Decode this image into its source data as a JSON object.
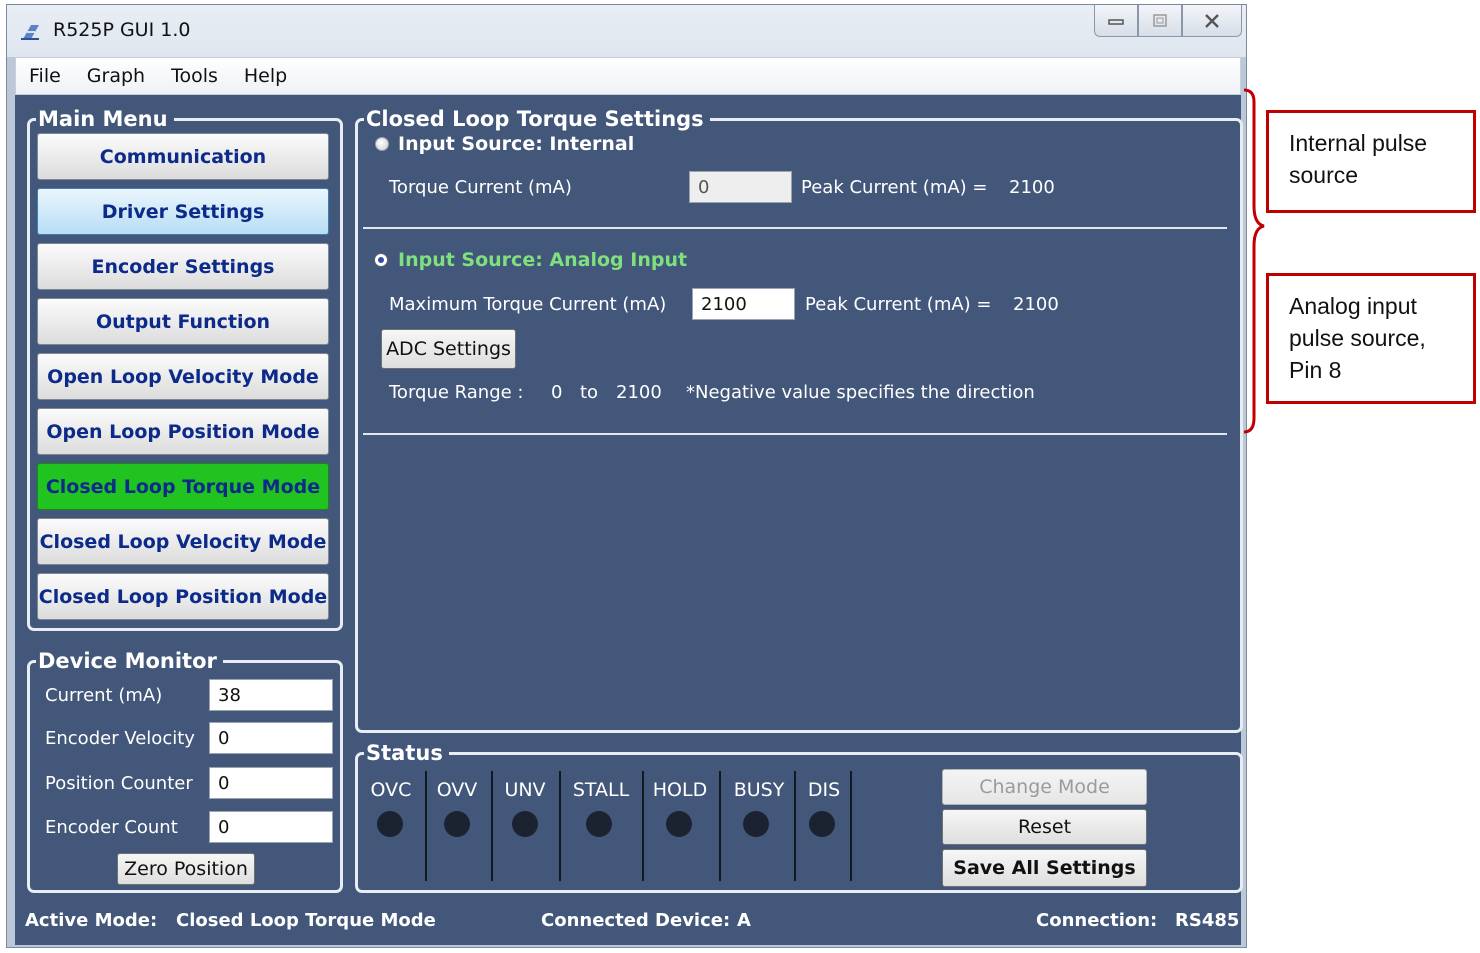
{
  "window": {
    "title": "R525P GUI 1.0"
  },
  "menubar": [
    "File",
    "Graph",
    "Tools",
    "Help"
  ],
  "main_menu": {
    "title": "Main Menu",
    "items": [
      {
        "label": "Communication",
        "state": "normal"
      },
      {
        "label": "Driver Settings",
        "state": "hover"
      },
      {
        "label": "Encoder Settings",
        "state": "normal"
      },
      {
        "label": "Output Function",
        "state": "normal"
      },
      {
        "label": "Open Loop Velocity Mode",
        "state": "normal"
      },
      {
        "label": "Open Loop Position Mode",
        "state": "normal"
      },
      {
        "label": "Closed Loop Torque Mode",
        "state": "active"
      },
      {
        "label": "Closed Loop Velocity Mode",
        "state": "normal"
      },
      {
        "label": "Closed Loop Position Mode",
        "state": "normal"
      }
    ]
  },
  "device_monitor": {
    "title": "Device Monitor",
    "fields": [
      {
        "label": "Current (mA)",
        "value": "38"
      },
      {
        "label": "Encoder Velocity",
        "value": "0"
      },
      {
        "label": "Position Counter",
        "value": "0"
      },
      {
        "label": "Encoder Count",
        "value": "0"
      }
    ],
    "zero_button": "Zero Position"
  },
  "settings": {
    "title": "Closed Loop Torque Settings",
    "internal": {
      "radio_label": "Input Source: Internal",
      "selected": false,
      "torque_label": "Torque Current (mA)",
      "torque_value": "0",
      "peak_label": "Peak Current (mA) =",
      "peak_value": "2100"
    },
    "analog": {
      "radio_label": "Input Source: Analog Input",
      "selected": true,
      "max_label": "Maximum Torque Current (mA)",
      "max_value": "2100",
      "peak_label": "Peak Current (mA) =",
      "peak_value": "2100",
      "adc_button": "ADC Settings",
      "range_label": "Torque Range :",
      "range_min": "0",
      "range_to": "to",
      "range_max": "2100",
      "range_note": "*Negative value specifies the direction"
    }
  },
  "status": {
    "title": "Status",
    "indicators": [
      "OVC",
      "OVV",
      "UNV",
      "STALL",
      "HOLD",
      "BUSY",
      "DIS"
    ],
    "change_mode_button": "Change Mode",
    "reset_button": "Reset",
    "save_button": "Save All Settings"
  },
  "footer": {
    "active_mode_label": "Active Mode:",
    "active_mode_value": "Closed Loop Torque Mode",
    "device_label": "Connected Device:",
    "device_value": "A",
    "connection_label": "Connection:",
    "connection_value": "RS485"
  },
  "annotations": {
    "internal_lines": [
      "Internal pulse",
      "source"
    ],
    "analog_lines": [
      "Analog input",
      "pulse source,",
      "Pin 8"
    ]
  },
  "colors": {
    "panel_bg": "#43577a",
    "active_mode_green": "#21c321",
    "analog_label_green": "#7fe07f",
    "annotation_red": "#c00000"
  }
}
